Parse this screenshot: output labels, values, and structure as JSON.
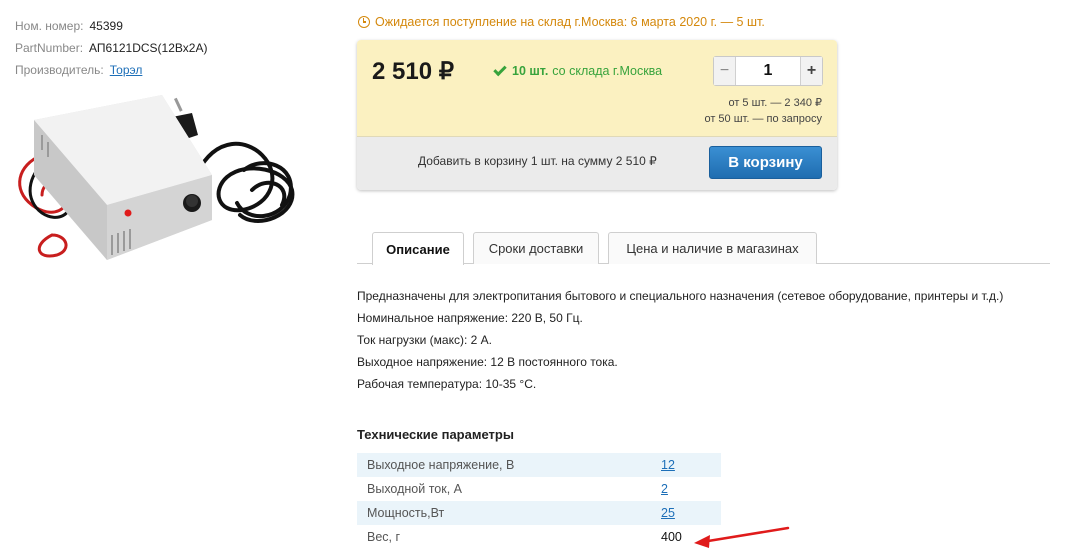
{
  "meta": {
    "stock_number": {
      "label": "Ном. номер:",
      "value": "45399"
    },
    "part_number": {
      "label": "PartNumber:",
      "value": "АП6121DCS(12Вх2А)"
    },
    "manufacturer": {
      "label": "Производитель:",
      "value": "Торэл"
    }
  },
  "arrival_notice": "Ожидается поступление на склад г.Москва: 6 марта 2020 г. — 5 шт.",
  "buybox": {
    "price": "2 510 ₽",
    "stock_qty": "10 шт.",
    "stock_source": "со склада г.Москва",
    "stepper": {
      "minus": "−",
      "plus": "+",
      "quantity": "1"
    },
    "tier_1": "от 5 шт. — 2 340 ₽",
    "tier_2": "от 50 шт. — по запросу",
    "cart_summary": "Добавить в корзину 1 шт. на сумму 2 510 ₽",
    "cart_button": "В корзину"
  },
  "tabs": [
    {
      "label": "Описание",
      "active": true
    },
    {
      "label": "Сроки доставки",
      "active": false
    },
    {
      "label": "Цена и наличие в магазинах",
      "active": false
    }
  ],
  "description": [
    "Предназначены для электропитания бытового и специального назначения (сетевое оборудование, принтеры и т.д.)",
    "Номинальное напряжение: 220 В, 50 Гц.",
    "Ток нагрузки (макс): 2 А.",
    "Выходное напряжение: 12 В постоянного тока.",
    "Рабочая температура: 10-35 °С."
  ],
  "specs": {
    "title": "Технические параметры",
    "rows": [
      {
        "name": "Выходное напряжение, В",
        "value": "12"
      },
      {
        "name": "Выходной ток, А",
        "value": "2"
      },
      {
        "name": "Мощность,Вт",
        "value": "25"
      },
      {
        "name": "Вес, г",
        "value": "400"
      }
    ]
  },
  "colors": {
    "accent_blue": "#1f6db0",
    "warning_orange": "#d4880c",
    "stock_green": "#37a33c",
    "buybox_yellow": "#fbf1c1",
    "arrow_red": "#e01b1b"
  },
  "icons": [
    "clock-icon",
    "check-icon",
    "minus-icon",
    "plus-icon",
    "arrow-icon"
  ]
}
